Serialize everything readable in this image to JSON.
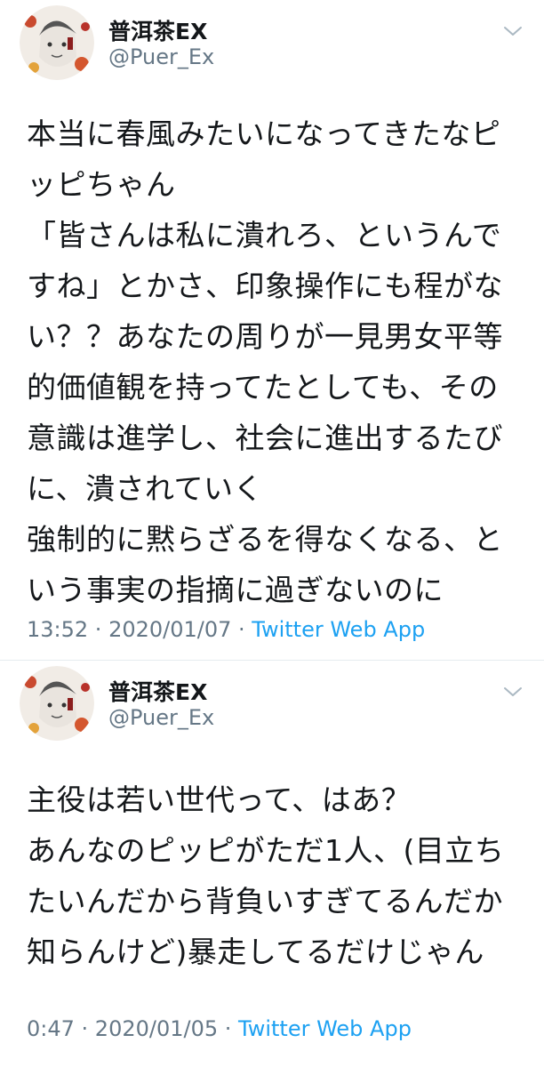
{
  "tweets": [
    {
      "author": {
        "name": "普洱茶EX",
        "handle": "@Puer_Ex"
      },
      "lines": [
        "本当に春風みたいになってきたなピ",
        "ッピちゃん",
        "「皆さんは私に潰れろ、というんで",
        "すね」とかさ、印象操作にも程がな",
        "い？？あなたの周りが一見男女平等",
        "的価値観を持ってたとしても、その",
        "意識は進学し、社会に進出するたび",
        "に、潰されていく",
        "強制的に黙らざるを得なくなる、と",
        "いう事実の指摘に過ぎないのに"
      ],
      "time": "13:52",
      "date": "2020/01/07",
      "separator": " · ",
      "source": "Twitter Web App"
    },
    {
      "author": {
        "name": "普洱茶EX",
        "handle": "@Puer_Ex"
      },
      "lines": [
        "主役は若い世代って、はあ？",
        "あんなのピッピがただ1人、(目立ち",
        "たいんだから背負いすぎてるんだか",
        "知らんけど)暴走してるだけじゃん"
      ],
      "time": "0:47",
      "date": "2020/01/05",
      "separator": " · ",
      "source": "Twitter Web App"
    }
  ],
  "colors": {
    "text": "#14171a",
    "secondary": "#657786",
    "link": "#1da1f2",
    "divider": "#e6ecf0"
  },
  "icons": {
    "more": "chevron-down-icon",
    "avatar": "user-avatar"
  }
}
